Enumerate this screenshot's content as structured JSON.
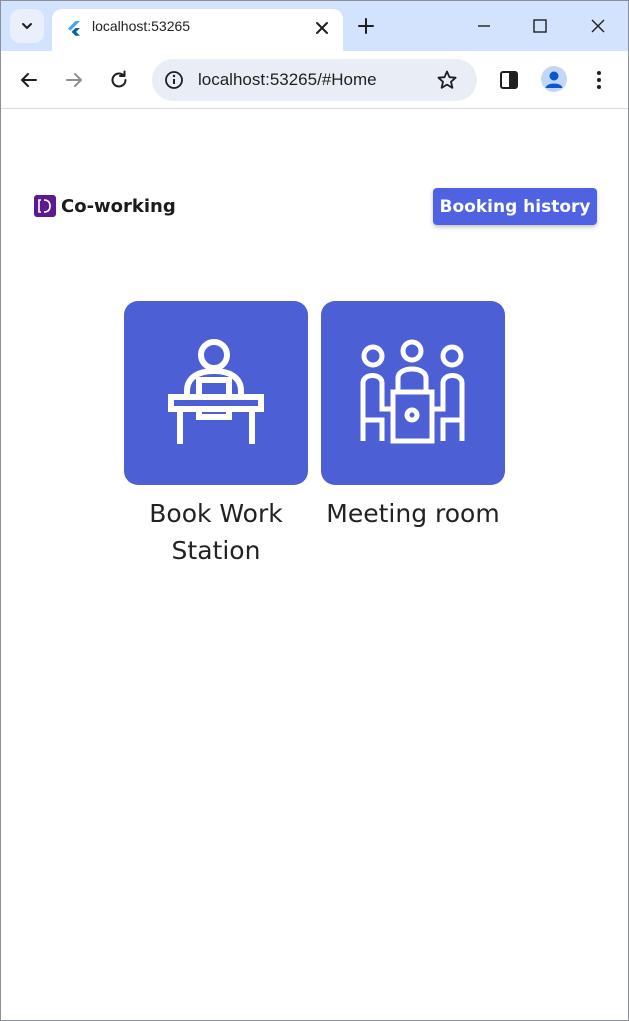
{
  "browser": {
    "tab_title": "localhost:53265",
    "url": "localhost:53265/#Home",
    "icons": {
      "tab_search": "chevron-down-icon",
      "favicon": "flutter-icon",
      "tab_close": "close-icon",
      "new_tab": "plus-icon",
      "minimize": "minimize-icon",
      "maximize": "maximize-icon",
      "close": "close-icon",
      "back": "back-arrow-icon",
      "forward": "forward-arrow-icon",
      "reload": "reload-icon",
      "site_info": "info-icon",
      "bookmark": "star-icon",
      "side_panel": "side-panel-icon",
      "profile": "avatar-icon",
      "menu": "kebab-menu-icon"
    },
    "colors": {
      "tabstrip": "#d3e3fd",
      "omnibox": "#e9eef6"
    }
  },
  "app": {
    "brand_name": "Co-working",
    "booking_history_label": "Booking history",
    "cards": [
      {
        "label": "Book Work Station",
        "icon": "workstation-desk-icon"
      },
      {
        "label": "Meeting room",
        "icon": "meeting-room-icon"
      }
    ],
    "colors": {
      "accent": "#4f63e2",
      "tile": "#4c5fd5",
      "logo": "#5b1b8f"
    }
  }
}
